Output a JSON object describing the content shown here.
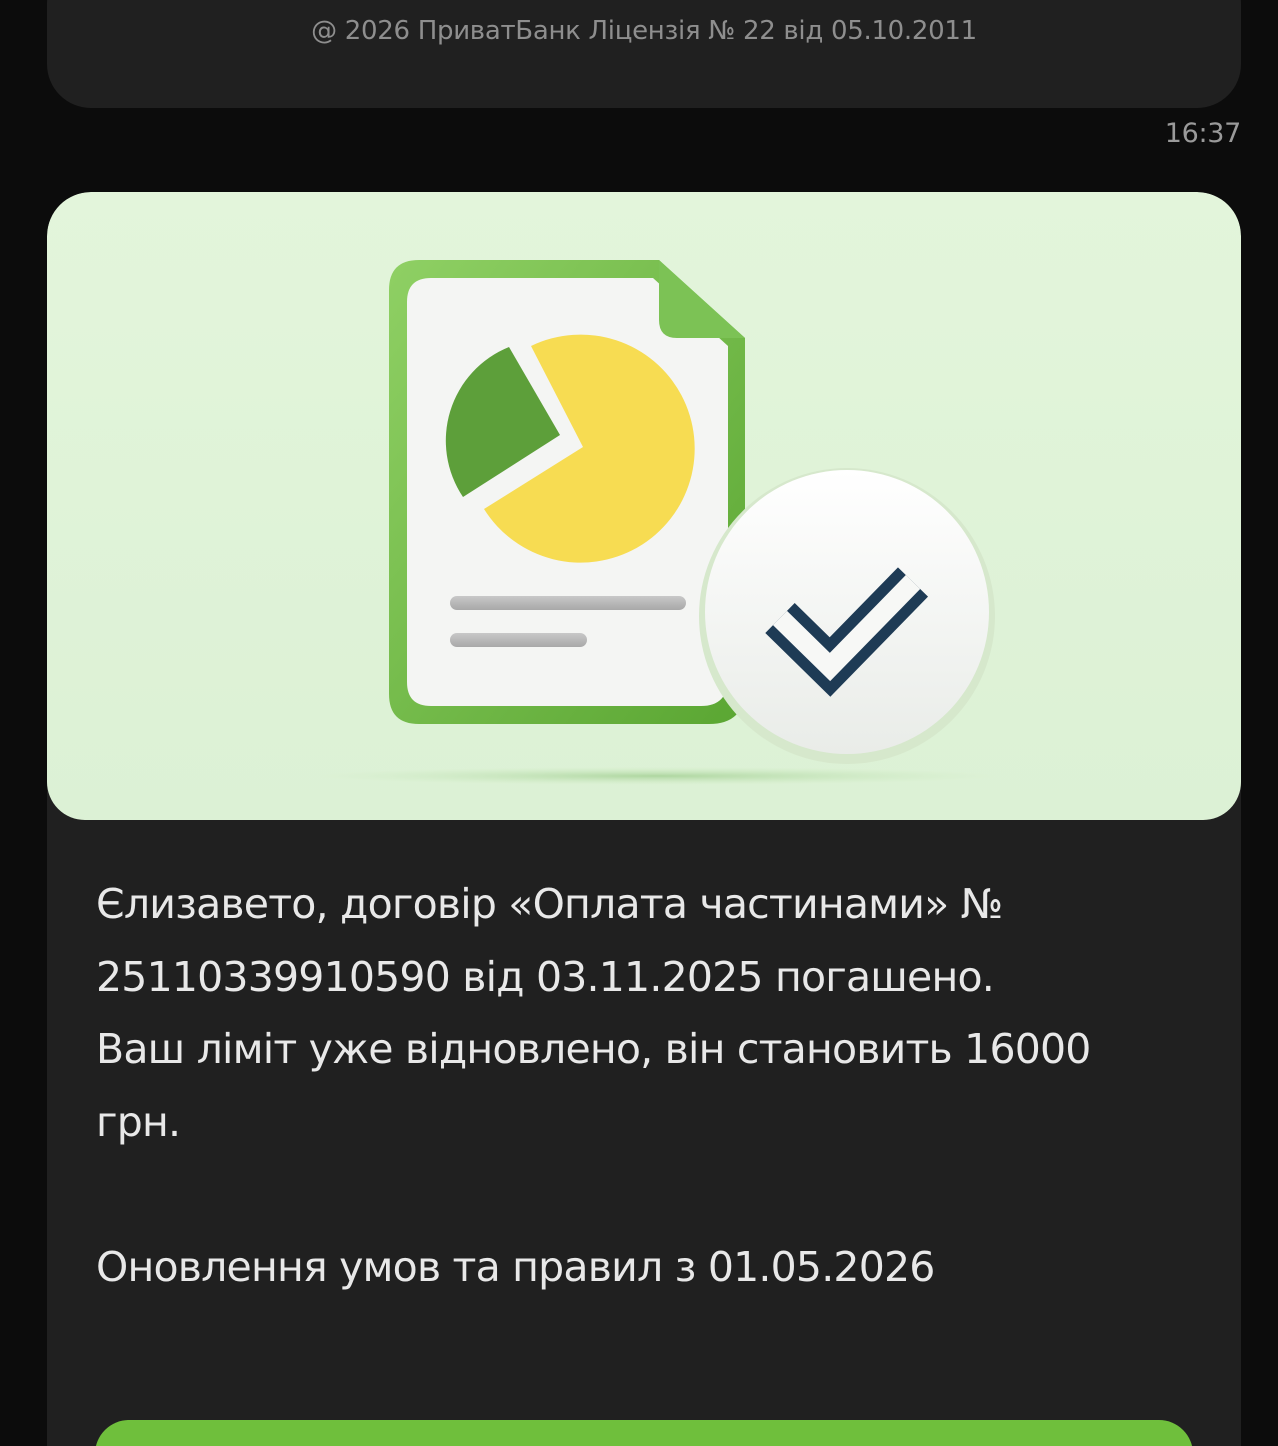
{
  "previous_message": {
    "footer": "@ 2026 ПриватБанк Ліцензія № 22 від 05.10.2011"
  },
  "timestamp": "16:37",
  "message": {
    "banner_icon": "document-pie-chart-check-icon",
    "lines": [
      "Єлизавето, договір «Оплата частинами» №",
      "25110339910590 від 03.11.2025 погашено.",
      "Ваш ліміт уже відновлено, він становить 16000",
      "грн."
    ],
    "update_notice": "Оновлення умов та правил з 01.05.2026"
  },
  "colors": {
    "background": "#0c0c0c",
    "bubble": "#202020",
    "banner": "#dff3d8",
    "accent_green": "#6fbf3c",
    "chart_yellow": "#f7dc52",
    "chart_green": "#5d9f3a",
    "check_navy": "#1e3b55"
  }
}
